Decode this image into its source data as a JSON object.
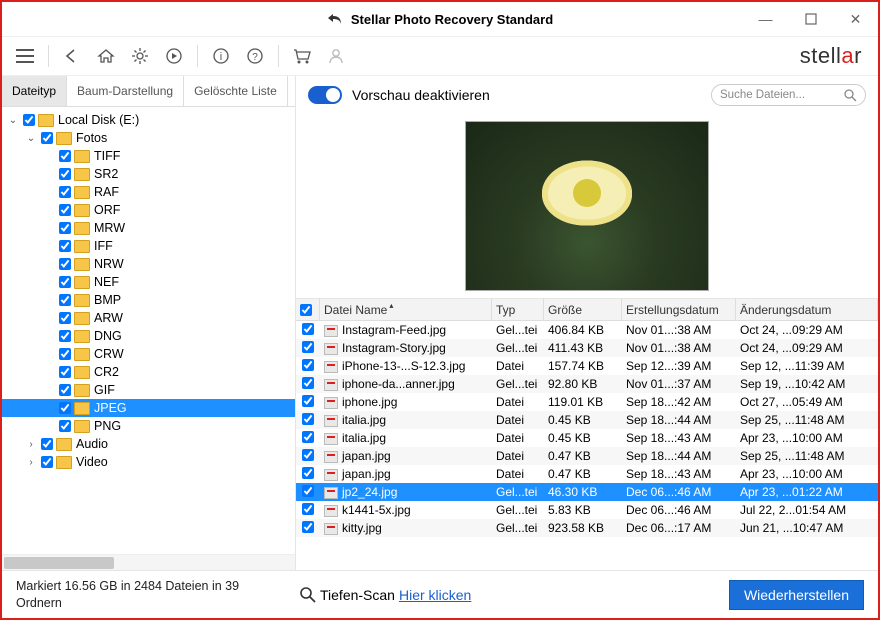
{
  "title": "Stellar Photo Recovery Standard",
  "brand_parts": [
    "stell",
    "a",
    "r"
  ],
  "tabs": [
    "Dateityp",
    "Baum-Darstellung",
    "Gelöschte Liste"
  ],
  "preview_toggle_label": "Vorschau deaktivieren",
  "search_placeholder": "Suche Dateien...",
  "tree": {
    "root": "Local Disk (E:)",
    "fotos": "Fotos",
    "types": [
      "TIFF",
      "SR2",
      "RAF",
      "ORF",
      "MRW",
      "IFF",
      "NRW",
      "NEF",
      "BMP",
      "ARW",
      "DNG",
      "CRW",
      "CR2",
      "GIF",
      "JPEG",
      "PNG"
    ],
    "selected": "JPEG",
    "audio": "Audio",
    "video": "Video"
  },
  "table": {
    "headers": [
      "Datei Name",
      "Typ",
      "Größe",
      "Erstellungsdatum",
      "Änderungsdatum"
    ],
    "rows": [
      {
        "name": "Instagram-Feed.jpg",
        "typ": "Gel...tei",
        "size": "406.84 KB",
        "create": "Nov 01...:38 AM",
        "mod": "Oct 24, ...09:29 AM"
      },
      {
        "name": "Instagram-Story.jpg",
        "typ": "Gel...tei",
        "size": "411.43 KB",
        "create": "Nov 01...:38 AM",
        "mod": "Oct 24, ...09:29 AM"
      },
      {
        "name": "iPhone-13-...S-12.3.jpg",
        "typ": "Datei",
        "size": "157.74 KB",
        "create": "Sep 12...:39 AM",
        "mod": "Sep 12, ...11:39 AM"
      },
      {
        "name": "iphone-da...anner.jpg",
        "typ": "Gel...tei",
        "size": "92.80 KB",
        "create": "Nov 01...:37 AM",
        "mod": "Sep 19, ...10:42 AM"
      },
      {
        "name": "iphone.jpg",
        "typ": "Datei",
        "size": "119.01 KB",
        "create": "Sep 18...:42 AM",
        "mod": "Oct 27, ...05:49 AM"
      },
      {
        "name": "italia.jpg",
        "typ": "Datei",
        "size": "0.45 KB",
        "create": "Sep 18...:44 AM",
        "mod": "Sep 25, ...11:48 AM"
      },
      {
        "name": "italia.jpg",
        "typ": "Datei",
        "size": "0.45 KB",
        "create": "Sep 18...:43 AM",
        "mod": "Apr 23, ...10:00 AM"
      },
      {
        "name": "japan.jpg",
        "typ": "Datei",
        "size": "0.47 KB",
        "create": "Sep 18...:44 AM",
        "mod": "Sep 25, ...11:48 AM"
      },
      {
        "name": "japan.jpg",
        "typ": "Datei",
        "size": "0.47 KB",
        "create": "Sep 18...:43 AM",
        "mod": "Apr 23, ...10:00 AM"
      },
      {
        "name": "jp2_24.jpg",
        "typ": "Gel...tei",
        "size": "46.30 KB",
        "create": "Dec 06...:46 AM",
        "mod": "Apr 23, ...01:22 AM",
        "selected": true
      },
      {
        "name": "k1441-5x.jpg",
        "typ": "Gel...tei",
        "size": "5.83 KB",
        "create": "Dec 06...:46 AM",
        "mod": "Jul 22, 2...01:54 AM"
      },
      {
        "name": "kitty.jpg",
        "typ": "Gel...tei",
        "size": "923.58 KB",
        "create": "Dec 06...:17 AM",
        "mod": "Jun 21, ...10:47 AM"
      }
    ]
  },
  "footer": {
    "status": "Markiert 16.56 GB in 2484 Dateien in 39 Ordnern",
    "deep_label": "Tiefen-Scan",
    "deep_link": "Hier klicken",
    "restore": "Wiederherstellen"
  }
}
